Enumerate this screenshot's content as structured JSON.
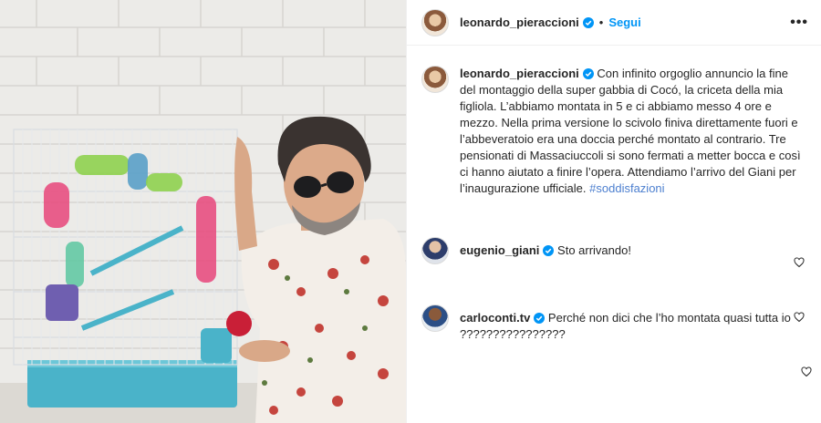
{
  "post": {
    "author": "leonardo_pieraccioni",
    "separator": "•",
    "follow_label": "Segui",
    "more_label": "•••",
    "caption": "Con infinito orgoglio annuncio la fine del montaggio della super gabbia di Cocó, la criceta della mia figliola. L’abbiamo montata in 5 e ci abbiamo messo 4 ore e mezzo. Nella prima versione lo scivolo finiva direttamente fuori e l’abbeveratoio era una doccia perché montato al contrario. Tre pensionati di Massaciuccoli si sono fermati a metter bocca e così ci hanno aiutato a finire l’opera. Attendiamo l’arrivo del Giani per l’inaugurazione ufficiale.",
    "hashtag": "#soddisfazioni"
  },
  "comments": [
    {
      "user": "eugenio_giani",
      "text": "Sto arrivando!"
    },
    {
      "user": "carloconti.tv",
      "text": "Perché non dici che l’ho montata quasi tutta io ????????????????"
    }
  ],
  "colors": {
    "link": "#0095f6",
    "verified": "#0095f6",
    "hashtag": "#4c7fcf",
    "text": "#262626"
  }
}
